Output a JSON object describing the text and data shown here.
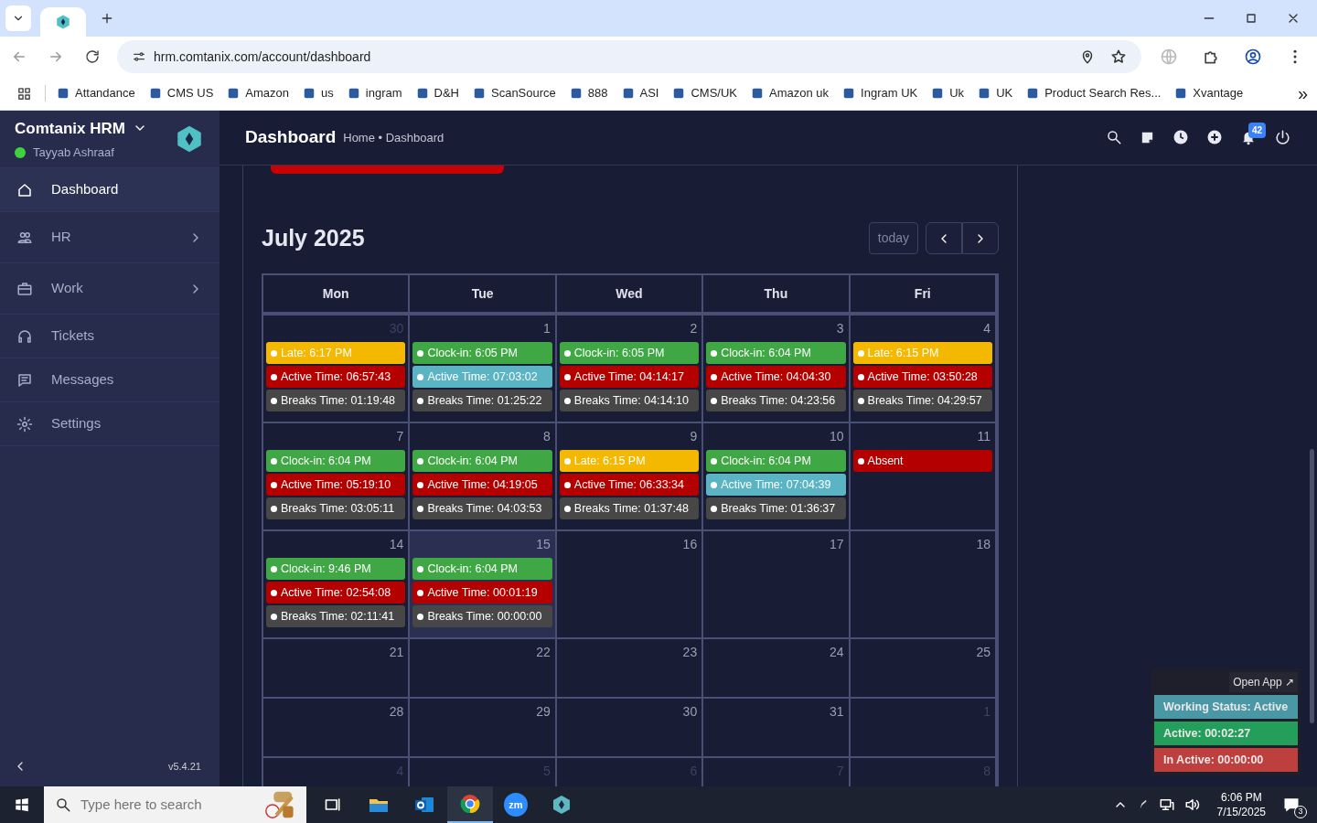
{
  "browser": {
    "url": "hrm.comtanix.com/account/dashboard",
    "bookmarks": [
      "Attandance",
      "CMS US",
      "Amazon",
      "us",
      "ingram",
      "D&H",
      "ScanSource",
      "888",
      "ASI",
      "CMS/UK",
      "Amazon uk",
      "Ingram UK",
      "Uk",
      "UK",
      "Product Search Res...",
      "Xvantage"
    ],
    "bookmarks_overflow": "»"
  },
  "sidebar": {
    "app_name": "Comtanix HRM",
    "user": "Tayyab Ashraaf",
    "online": true,
    "items": [
      {
        "label": "Dashboard",
        "kind": "home",
        "selected": true,
        "has_children": false
      },
      {
        "label": "HR",
        "kind": "people",
        "selected": false,
        "has_children": true
      },
      {
        "label": "Work",
        "kind": "briefcase",
        "selected": false,
        "has_children": true
      },
      {
        "label": "Tickets",
        "kind": "headset",
        "selected": false,
        "has_children": false
      },
      {
        "label": "Messages",
        "kind": "chat",
        "selected": false,
        "has_children": false
      },
      {
        "label": "Settings",
        "kind": "gear",
        "selected": false,
        "has_children": false
      }
    ],
    "version": "v5.4.21"
  },
  "header": {
    "title": "Dashboard",
    "breadcrumb": "Home • Dashboard",
    "notification_count": "42"
  },
  "calendar": {
    "title": "July 2025",
    "today_button": {
      "label": "today",
      "disabled": true
    },
    "weekdays": [
      "Mon",
      "Tue",
      "Wed",
      "Thu",
      "Fri"
    ],
    "weeks": [
      [
        {
          "day": "30",
          "other_month": true,
          "today": false,
          "events": [
            {
              "kind": "late",
              "text": "Late: 6:17 PM"
            },
            {
              "kind": "active",
              "text": "Active Time: 06:57:43"
            },
            {
              "kind": "breaks",
              "text": "Breaks Time: 01:19:48"
            }
          ]
        },
        {
          "day": "1",
          "other_month": false,
          "today": false,
          "events": [
            {
              "kind": "clockin",
              "text": "Clock-in: 6:05 PM"
            },
            {
              "kind": "active_full",
              "text": "Active Time: 07:03:02"
            },
            {
              "kind": "breaks",
              "text": "Breaks Time: 01:25:22"
            }
          ]
        },
        {
          "day": "2",
          "other_month": false,
          "today": false,
          "events": [
            {
              "kind": "clockin",
              "text": "Clock-in: 6:05 PM"
            },
            {
              "kind": "active",
              "text": "Active Time: 04:14:17"
            },
            {
              "kind": "breaks",
              "text": "Breaks Time: 04:14:10"
            }
          ]
        },
        {
          "day": "3",
          "other_month": false,
          "today": false,
          "events": [
            {
              "kind": "clockin",
              "text": "Clock-in: 6:04 PM"
            },
            {
              "kind": "active",
              "text": "Active Time: 04:04:30"
            },
            {
              "kind": "breaks",
              "text": "Breaks Time: 04:23:56"
            }
          ]
        },
        {
          "day": "4",
          "other_month": false,
          "today": false,
          "events": [
            {
              "kind": "late",
              "text": "Late: 6:15 PM"
            },
            {
              "kind": "active",
              "text": "Active Time: 03:50:28"
            },
            {
              "kind": "breaks",
              "text": "Breaks Time: 04:29:57"
            }
          ]
        }
      ],
      [
        {
          "day": "7",
          "other_month": false,
          "today": false,
          "events": [
            {
              "kind": "clockin",
              "text": "Clock-in: 6:04 PM"
            },
            {
              "kind": "active",
              "text": "Active Time: 05:19:10"
            },
            {
              "kind": "breaks",
              "text": "Breaks Time: 03:05:11"
            }
          ]
        },
        {
          "day": "8",
          "other_month": false,
          "today": false,
          "events": [
            {
              "kind": "clockin",
              "text": "Clock-in: 6:04 PM"
            },
            {
              "kind": "active",
              "text": "Active Time: 04:19:05"
            },
            {
              "kind": "breaks",
              "text": "Breaks Time: 04:03:53"
            }
          ]
        },
        {
          "day": "9",
          "other_month": false,
          "today": false,
          "events": [
            {
              "kind": "late",
              "text": "Late: 6:15 PM"
            },
            {
              "kind": "active",
              "text": "Active Time: 06:33:34"
            },
            {
              "kind": "breaks",
              "text": "Breaks Time: 01:37:48"
            }
          ]
        },
        {
          "day": "10",
          "other_month": false,
          "today": false,
          "events": [
            {
              "kind": "clockin",
              "text": "Clock-in: 6:04 PM"
            },
            {
              "kind": "active_full",
              "text": "Active Time: 07:04:39"
            },
            {
              "kind": "breaks",
              "text": "Breaks Time: 01:36:37"
            }
          ]
        },
        {
          "day": "11",
          "other_month": false,
          "today": false,
          "events": [
            {
              "kind": "absent",
              "text": "Absent"
            }
          ]
        }
      ],
      [
        {
          "day": "14",
          "other_month": false,
          "today": false,
          "events": [
            {
              "kind": "clockin",
              "text": "Clock-in: 9:46 PM"
            },
            {
              "kind": "active",
              "text": "Active Time: 02:54:08"
            },
            {
              "kind": "breaks",
              "text": "Breaks Time: 02:11:41"
            }
          ]
        },
        {
          "day": "15",
          "other_month": false,
          "today": true,
          "events": [
            {
              "kind": "clockin",
              "text": "Clock-in: 6:04 PM"
            },
            {
              "kind": "active",
              "text": "Active Time: 00:01:19"
            },
            {
              "kind": "breaks",
              "text": "Breaks Time: 00:00:00"
            }
          ]
        },
        {
          "day": "16",
          "other_month": false,
          "today": false
        },
        {
          "day": "17",
          "other_month": false,
          "today": false
        },
        {
          "day": "18",
          "other_month": false,
          "today": false
        }
      ],
      [
        {
          "day": "21",
          "other_month": false,
          "today": false
        },
        {
          "day": "22",
          "other_month": false,
          "today": false
        },
        {
          "day": "23",
          "other_month": false,
          "today": false
        },
        {
          "day": "24",
          "other_month": false,
          "today": false
        },
        {
          "day": "25",
          "other_month": false,
          "today": false
        }
      ],
      [
        {
          "day": "28",
          "other_month": false,
          "today": false
        },
        {
          "day": "29",
          "other_month": false,
          "today": false
        },
        {
          "day": "30",
          "other_month": false,
          "today": false
        },
        {
          "day": "31",
          "other_month": false,
          "today": false
        },
        {
          "day": "1",
          "other_month": true,
          "today": false
        }
      ],
      [
        {
          "day": "4",
          "other_month": true,
          "today": false
        },
        {
          "day": "5",
          "other_month": true,
          "today": false
        },
        {
          "day": "6",
          "other_month": true,
          "today": false
        },
        {
          "day": "7",
          "other_month": true,
          "today": false
        },
        {
          "day": "8",
          "other_month": true,
          "today": false
        }
      ]
    ]
  },
  "status_widget": {
    "open_app": "Open App ↗",
    "rows": [
      {
        "kind": "status",
        "text": "Working Status: Active"
      },
      {
        "kind": "active",
        "text": "Active: 00:02:27"
      },
      {
        "kind": "inactive",
        "text": "In Active: 00:00:00"
      }
    ]
  },
  "taskbar": {
    "search_placeholder": "Type here to search",
    "apps": [
      {
        "kind": "taskview",
        "active": false
      },
      {
        "kind": "files",
        "active": false
      },
      {
        "kind": "mail",
        "active": false
      },
      {
        "kind": "browser",
        "active": true
      },
      {
        "kind": "zoom",
        "label": "zm",
        "active": false
      },
      {
        "kind": "hrm",
        "active": false
      }
    ],
    "time": "6:06 PM",
    "date": "7/15/2025",
    "notification_count": "3"
  }
}
